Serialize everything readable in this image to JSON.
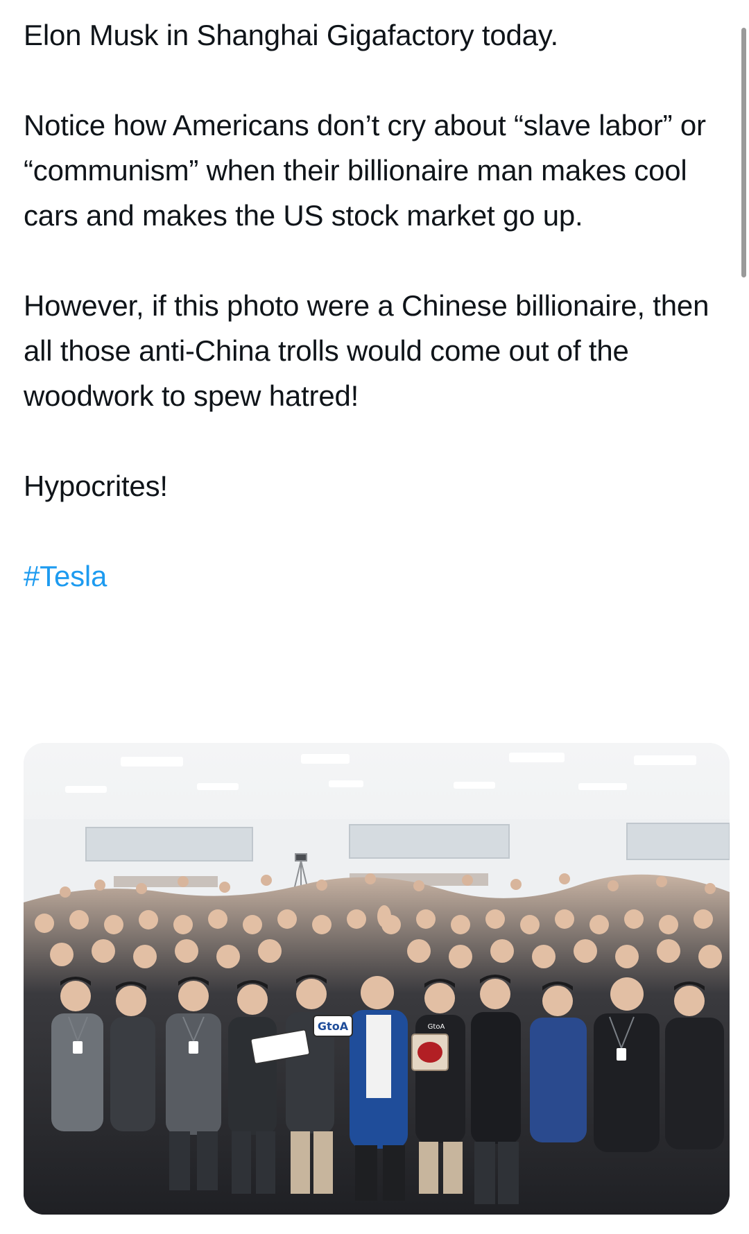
{
  "tweet": {
    "line_intro": "Elon Musk in Shanghai Gigafactory today.",
    "para_notice": "Notice how Americans don’t cry about “slave labor” or “communism” when their billionaire man makes cool cars and makes the US stock market go up.",
    "para_however": "However, if this photo were a Chinese billionaire, then all those anti-China trolls would come out of the woodwork to spew hatred!",
    "para_closing": "Hypocrites!",
    "hashtag": "#Tesla"
  },
  "media": {
    "sign_text": "GtoA",
    "shirt_text": "GtoA"
  },
  "colors": {
    "text": "#0f1419",
    "link": "#1d9bf0",
    "background": "#ffffff"
  }
}
